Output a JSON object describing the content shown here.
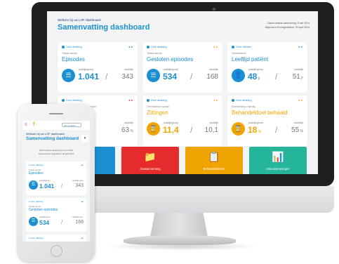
{
  "desktop": {
    "welcome": "Welkom bij uw LOF dashboard",
    "title": "Samenvatting dashboard",
    "meta_line1": "Datum laatste aanlevering: 8 mei 2024",
    "meta_line2": "Afgevoerd t/m begindatum: 30 april 2024",
    "cards": [
      {
        "sub": "Over afdeling",
        "flags": "●●",
        "kicker": "Totaal aantal",
        "title": "Episodes",
        "icon": "☰",
        "lbl1": "praktijk/groep",
        "value": "1.041",
        "unit": "",
        "lbl2": "landelijk",
        "compare": "343",
        "compare_unit": "",
        "theme": "blue"
      },
      {
        "sub": "Over afdeling",
        "flags": "●●",
        "kicker": "Totaal aantal",
        "title": "Gesloten episodes",
        "icon": "☰",
        "lbl1": "praktijk/groep",
        "value": "534",
        "unit": "",
        "lbl2": "landelijk",
        "compare": "168",
        "compare_unit": "",
        "theme": "blue"
      },
      {
        "sub": "Over cliënten",
        "flags": "●●",
        "kicker": "Gemiddelde",
        "title": "Leeftijd patiënt",
        "icon": "👤",
        "lbl1": "praktijk/groep",
        "value": "48",
        "unit": " jr",
        "lbl2": "landelijk",
        "compare": "51",
        "compare_unit": " jr",
        "theme": "blue"
      },
      {
        "sub": "Over afdeling",
        "flags": "●●",
        "kicker": "Percentage gebruik compleet",
        "title": "ing",
        "icon": "☰",
        "lbl1": "praktijk/groep",
        "value": "",
        "unit": "",
        "lbl2": "landelijk",
        "compare": "63",
        "compare_unit": " %",
        "theme": "orange"
      },
      {
        "sub": "Over afdeling",
        "flags": "●●",
        "kicker": "Gemiddelde aantal",
        "title": "Zittingen",
        "icon": "⌛",
        "lbl1": "praktijk/groep",
        "value": "11,4",
        "unit": "",
        "lbl2": "landelijk",
        "compare": "10,1",
        "compare_unit": "",
        "theme": "orange"
      },
      {
        "sub": "Over afdeling",
        "flags": "●●",
        "kicker": "Doelstelling volledig",
        "title": "Behandeldoel behaald",
        "icon": "⌛",
        "lbl1": "praktijk/groep",
        "value": "18",
        "unit": " %",
        "lbl2": "landelijk",
        "compare": "55",
        "compare_unit": " %",
        "theme": "orange"
      }
    ],
    "tiles": [
      {
        "label": "me",
        "icon": "",
        "color": "#1a8fd1"
      },
      {
        "label": "Dossiervorming",
        "icon": "📁",
        "color": "#e52b2b"
      },
      {
        "label": "Behandeldoelen",
        "icon": "📋",
        "color": "#f0a400"
      },
      {
        "label": "Uitkomstmetingen",
        "icon": "📊",
        "color": "#24b59b"
      }
    ]
  },
  "mobile": {
    "menu_icon": "≡",
    "logo": "f",
    "pill": "Jan Janssen",
    "welcome": "Welkom bij uw LOF dashboard",
    "title": "Samenvatting dashboard",
    "select_icon": "▾",
    "meta_line1": "Datum laatste aanlevering: 8 mei 2024",
    "meta_line2": "Afgevoerd t/m begindatum: 30 april 2024",
    "cards": [
      {
        "sub": "● Over afdeling",
        "flags": "●●",
        "kicker": "Totaal aantal",
        "title": "Episodes",
        "icon": "☰",
        "lbl1": "praktijk/groep",
        "value": "1.041",
        "lbl2": "landelijk gem.",
        "compare": "343"
      },
      {
        "sub": "● Over afdeling",
        "flags": "●●",
        "kicker": "Totaal aantal",
        "title": "Gesloten episodes",
        "icon": "☰",
        "lbl1": "praktijk/groep",
        "value": "534",
        "lbl2": "landelijk gem.",
        "compare": "168"
      },
      {
        "sub": "● Over afdeling",
        "flags": "●●",
        "kicker": "",
        "title": "",
        "icon": "",
        "lbl1": "",
        "value": "",
        "lbl2": "",
        "compare": ""
      }
    ]
  }
}
